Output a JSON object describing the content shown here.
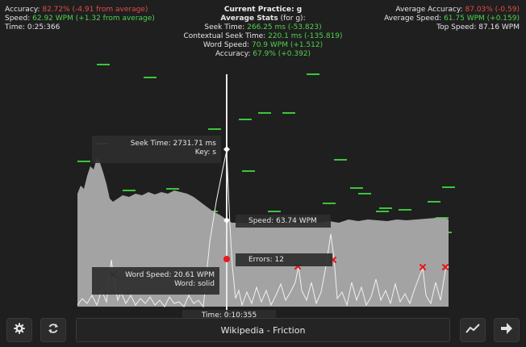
{
  "session": {
    "accuracy_label": "Accuracy:",
    "accuracy_value": "82.72% (-4.91 from average)",
    "speed_label": "Speed:",
    "speed_value": "62.92 WPM (+1.32 from average)",
    "time": "Time: 0:25:366"
  },
  "practice": {
    "title": "Current Practice: g",
    "average_stats_heading": "Average Stats",
    "average_stats_suffix": "(for g):",
    "seek_time_label": "Seek Time:",
    "seek_time_value": "266.25 ms (-53.823)",
    "contextual_seek_label": "Contextual Seek Time:",
    "contextual_seek_value": "220.1 ms (-135.819)",
    "word_speed_label": "Word Speed:",
    "word_speed_value": "70.9 WPM (+1.512)",
    "accuracy_label": "Accuracy:",
    "accuracy_value": "67.9% (+0.392)"
  },
  "overall": {
    "avg_accuracy_label": "Average Accuracy:",
    "avg_accuracy_value": "87.03% (-0.59)",
    "avg_speed_label": "Average Speed:",
    "avg_speed_value": "61.75 WPM (+0.159)",
    "top_speed": "Top Speed: 87.16 WPM"
  },
  "tooltips": {
    "seek_time": "Seek Time: 2731.71 ms",
    "key": "Key: s",
    "speed": "Speed: 63.74 WPM",
    "errors": "Errors: 12",
    "word_speed": "Word Speed: 20.61 WPM",
    "word": "Word: solid",
    "cursor_time": "Time: 0:10:355"
  },
  "text_source": "Wikipedia - Friction",
  "icons": {
    "settings": "gear-icon",
    "restart": "refresh-icon",
    "stats": "line-chart-icon",
    "next": "arrow-right-icon"
  },
  "colors": {
    "background": "#1f1f1f",
    "speed_area": "#a0a0a0",
    "seek_line": "#e0e0e0",
    "word_speed_marks": "#3cc43c",
    "error_marks": "#e02020",
    "negative": "#e84a4a",
    "positive": "#4fd14f"
  }
}
